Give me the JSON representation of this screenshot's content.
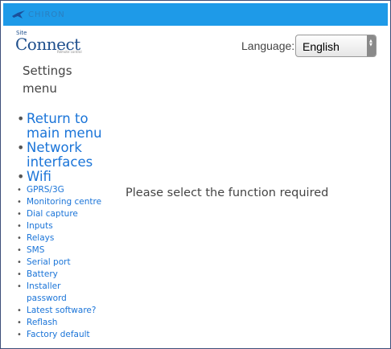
{
  "header": {
    "brand_name": "CHIRON",
    "brand_color": "#1e9ae8"
  },
  "logo": {
    "small_text": "Site",
    "main_text": "Connect",
    "tagline": "Remote control"
  },
  "language": {
    "label": "Language:",
    "selected": "English"
  },
  "settings_title": "Settings menu",
  "menu": {
    "items": [
      {
        "label": "Return to main menu"
      },
      {
        "label": "Network interfaces"
      },
      {
        "label": "Wifi"
      },
      {
        "label": "GPRS/3G"
      },
      {
        "label": "Monitoring centre"
      },
      {
        "label": "Dial capture"
      },
      {
        "label": "Inputs"
      },
      {
        "label": "Relays"
      },
      {
        "label": "SMS"
      },
      {
        "label": "Serial port"
      },
      {
        "label": "Battery"
      },
      {
        "label": "Installer password"
      },
      {
        "label": "Latest software?"
      },
      {
        "label": "Reflash"
      },
      {
        "label": "Factory default"
      }
    ]
  },
  "prompt": "Please select the function required",
  "colors": {
    "link": "#1a74d8",
    "text": "#444444"
  }
}
